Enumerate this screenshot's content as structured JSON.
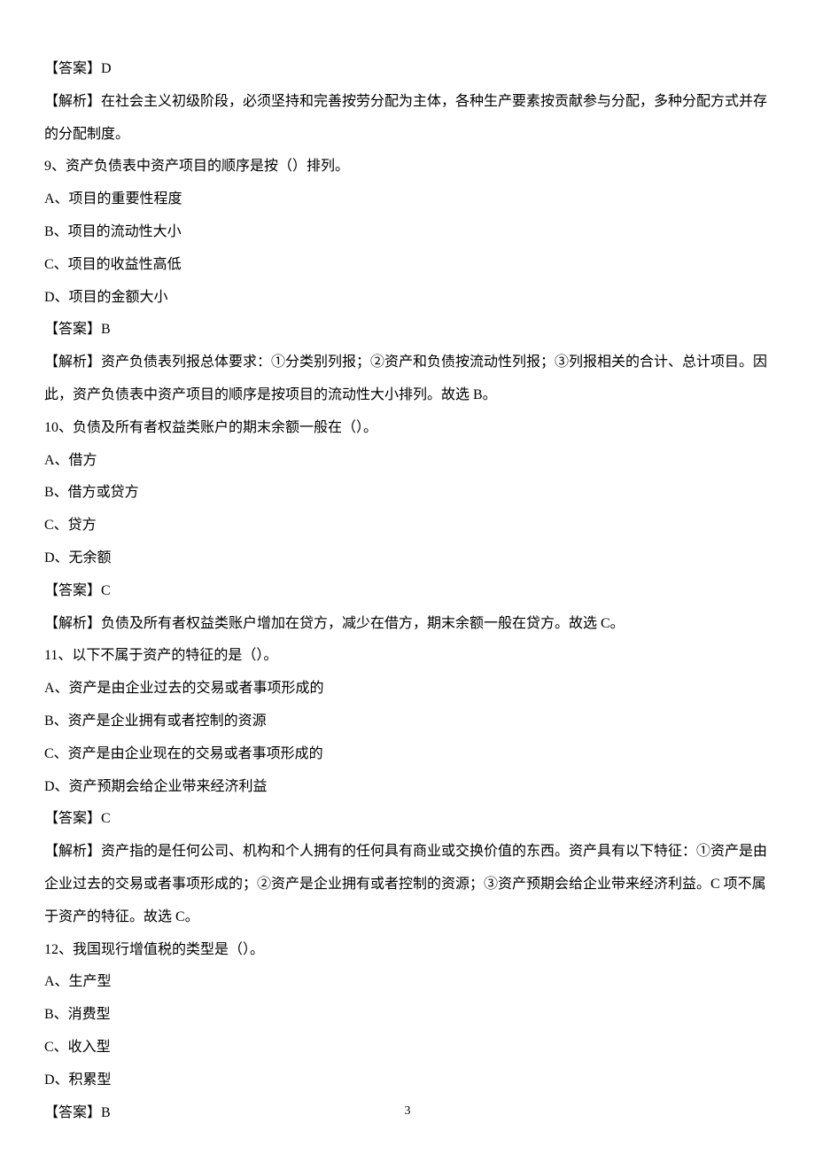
{
  "q8_answer_label": "【答案】D",
  "q8_explain": "【解析】在社会主义初级阶段，必须坚持和完善按劳分配为主体，各种生产要素按贡献参与分配，多种分配方式并存的分配制度。",
  "q9_stem": "9、资产负债表中资产项目的顺序是按（）排列。",
  "q9_a": "A、项目的重要性程度",
  "q9_b": "B、项目的流动性大小",
  "q9_c": "C、项目的收益性高低",
  "q9_d": "D、项目的金额大小",
  "q9_answer_label": "【答案】B",
  "q9_explain": "【解析】资产负债表列报总体要求：①分类别列报；②资产和负债按流动性列报；③列报相关的合计、总计项目。因此，资产负债表中资产项目的顺序是按项目的流动性大小排列。故选 B。",
  "q10_stem": "10、负债及所有者权益类账户的期末余额一般在（）。",
  "q10_a": "A、借方",
  "q10_b": "B、借方或贷方",
  "q10_c": "C、贷方",
  "q10_d": "D、无余额",
  "q10_answer_label": "【答案】C",
  "q10_explain": "【解析】负债及所有者权益类账户增加在贷方，减少在借方，期末余额一般在贷方。故选 C。",
  "q11_stem": "11、以下不属于资产的特征的是（）。",
  "q11_a": "A、资产是由企业过去的交易或者事项形成的",
  "q11_b": "B、资产是企业拥有或者控制的资源",
  "q11_c": "C、资产是由企业现在的交易或者事项形成的",
  "q11_d": "D、资产预期会给企业带来经济利益",
  "q11_answer_label": "【答案】C",
  "q11_explain": "【解析】资产指的是任何公司、机构和个人拥有的任何具有商业或交换价值的东西。资产具有以下特征：①资产是由企业过去的交易或者事项形成的；②资产是企业拥有或者控制的资源；③资产预期会给企业带来经济利益。C 项不属于资产的特征。故选 C。",
  "q12_stem": "12、我国现行增值税的类型是（）。",
  "q12_a": "A、生产型",
  "q12_b": "B、消费型",
  "q12_c": "C、收入型",
  "q12_d": "D、积累型",
  "q12_answer_label": "【答案】B",
  "page_number": "3"
}
